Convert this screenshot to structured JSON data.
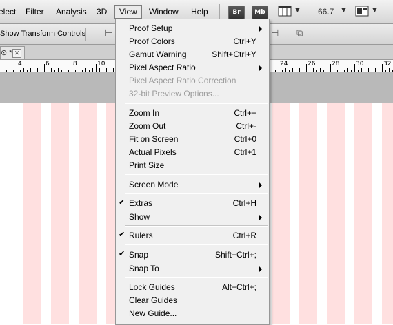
{
  "menubar": {
    "items": [
      {
        "label": "elect"
      },
      {
        "label": "Filter"
      },
      {
        "label": "Analysis"
      },
      {
        "label": "3D"
      },
      {
        "label": "View"
      },
      {
        "label": "Window"
      },
      {
        "label": "Help"
      }
    ],
    "buttons": {
      "bridge": "Br",
      "minibridge": "Mb"
    },
    "zoom_value": "66.7",
    "icons": [
      "grid-icon",
      "dropdown-arrow-icon",
      "arrange-documents-icon"
    ]
  },
  "options_bar": {
    "show_transform_controls": "Show Transform Controls"
  },
  "document_tab": {
    "label": "⊙ *"
  },
  "ruler": {
    "labels": [
      "4",
      "6",
      "8",
      "10",
      "24",
      "26",
      "28",
      "30",
      "32"
    ]
  },
  "colors": {
    "stripe": "#ffe0e0",
    "menu_bg": "#f0f0f0",
    "disabled_text": "#9b9b9b"
  },
  "view_menu": {
    "items": [
      {
        "label": "Proof Setup",
        "shortcut": "",
        "submenu": true,
        "checked": false,
        "disabled": false
      },
      {
        "label": "Proof Colors",
        "shortcut": "Ctrl+Y",
        "submenu": false,
        "checked": false,
        "disabled": false
      },
      {
        "label": "Gamut Warning",
        "shortcut": "Shift+Ctrl+Y",
        "submenu": false,
        "checked": false,
        "disabled": false
      },
      {
        "label": "Pixel Aspect Ratio",
        "shortcut": "",
        "submenu": true,
        "checked": false,
        "disabled": false
      },
      {
        "label": "Pixel Aspect Ratio Correction",
        "shortcut": "",
        "submenu": false,
        "checked": false,
        "disabled": true
      },
      {
        "label": "32-bit Preview Options...",
        "shortcut": "",
        "submenu": false,
        "checked": false,
        "disabled": true
      },
      {
        "label": "Zoom In",
        "shortcut": "Ctrl++",
        "submenu": false,
        "checked": false,
        "disabled": false
      },
      {
        "label": "Zoom Out",
        "shortcut": "Ctrl+-",
        "submenu": false,
        "checked": false,
        "disabled": false
      },
      {
        "label": "Fit on Screen",
        "shortcut": "Ctrl+0",
        "submenu": false,
        "checked": false,
        "disabled": false
      },
      {
        "label": "Actual Pixels",
        "shortcut": "Ctrl+1",
        "submenu": false,
        "checked": false,
        "disabled": false
      },
      {
        "label": "Print Size",
        "shortcut": "",
        "submenu": false,
        "checked": false,
        "disabled": false
      },
      {
        "label": "Screen Mode",
        "shortcut": "",
        "submenu": true,
        "checked": false,
        "disabled": false
      },
      {
        "label": "Extras",
        "shortcut": "Ctrl+H",
        "submenu": false,
        "checked": true,
        "disabled": false
      },
      {
        "label": "Show",
        "shortcut": "",
        "submenu": true,
        "checked": false,
        "disabled": false
      },
      {
        "label": "Rulers",
        "shortcut": "Ctrl+R",
        "submenu": false,
        "checked": true,
        "disabled": false
      },
      {
        "label": "Snap",
        "shortcut": "Shift+Ctrl+;",
        "submenu": false,
        "checked": true,
        "disabled": false
      },
      {
        "label": "Snap To",
        "shortcut": "",
        "submenu": true,
        "checked": false,
        "disabled": false
      },
      {
        "label": "Lock Guides",
        "shortcut": "Alt+Ctrl+;",
        "submenu": false,
        "checked": false,
        "disabled": false
      },
      {
        "label": "Clear Guides",
        "shortcut": "",
        "submenu": false,
        "checked": false,
        "disabled": false
      },
      {
        "label": "New Guide...",
        "shortcut": "",
        "submenu": false,
        "checked": false,
        "disabled": false
      }
    ]
  }
}
